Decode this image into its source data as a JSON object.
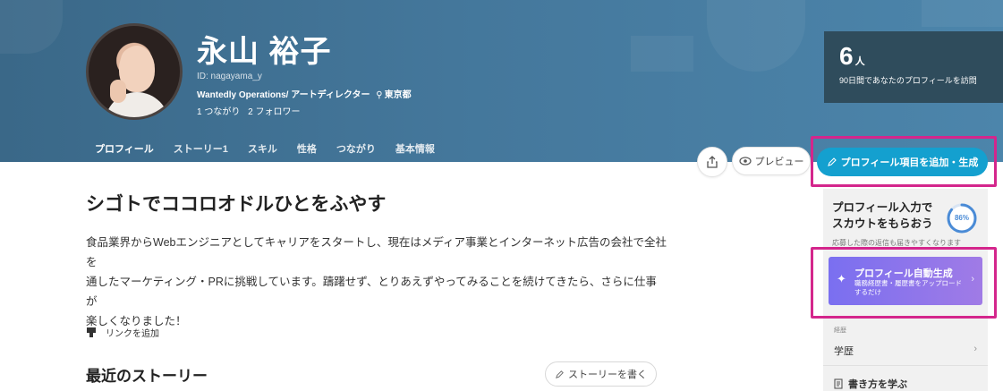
{
  "profile": {
    "name": "永山 裕子",
    "id": "ID: nagayama_y",
    "company": "Wantedly Operations",
    "title": "/ アートディレクター",
    "location": "東京都",
    "connections": "1 つながり",
    "followers": "2 フォロワー"
  },
  "tabs": [
    {
      "label": "プロフィール",
      "active": true
    },
    {
      "label": "ストーリー1"
    },
    {
      "label": "スキル"
    },
    {
      "label": "性格"
    },
    {
      "label": "つながり"
    },
    {
      "label": "基本情報"
    }
  ],
  "visits": {
    "count": "6",
    "unit": "人",
    "label": "90日間であなたのプロフィールを訪問"
  },
  "actions": {
    "preview_label": "プレビュー",
    "add_label": "プロフィール項目を追加・生成"
  },
  "content": {
    "headline": "シゴトでココロオドルひとをふやす",
    "bio_lines": [
      "食品業界からWebエンジニアとしてキャリアをスタートし、現在はメディア事業とインターネット広告の会社で全社を",
      "通したマーケティング・PRに挑戦しています。躊躇せず、とりあえずやってみることを続けてきたら、さらに仕事が",
      "楽しくなりました！"
    ],
    "link_label": "リンクを追加",
    "stories_title": "最近のストーリー",
    "write_story_label": "ストーリーを書く"
  },
  "panel": {
    "title_line1": "プロフィール入力で",
    "title_line2": "スカウトをもらおう",
    "progress_label": "86%",
    "progress": 0.86,
    "subtitle": "応募した際の返信も届きやすくなります",
    "auto_title": "プロフィール自動生成",
    "auto_desc": "職務経歴書・履歴書をアップロードするだけ",
    "section_small": "経歴",
    "item_label": "学歴",
    "learn_label": "書き方を学ぶ"
  },
  "colors": {
    "banner": "#44779b",
    "accent": "#14a0cf",
    "highlight": "#d4268c",
    "progress": "#4a8bd6"
  }
}
